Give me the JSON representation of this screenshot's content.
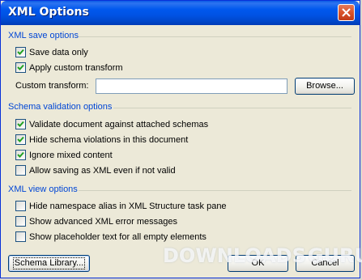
{
  "window": {
    "title": "XML Options",
    "close_icon": "close-icon"
  },
  "groups": {
    "save": {
      "title": "XML save options",
      "items": [
        {
          "label": "Save data only",
          "checked": true
        },
        {
          "label": "Apply custom transform",
          "checked": true
        }
      ],
      "custom_transform_label": "Custom transform:",
      "custom_transform_value": "",
      "browse_label": "Browse..."
    },
    "schema": {
      "title": "Schema validation options",
      "items": [
        {
          "label": "Validate document against attached schemas",
          "checked": true
        },
        {
          "label": "Hide schema violations in this document",
          "checked": true
        },
        {
          "label": "Ignore mixed content",
          "checked": true
        },
        {
          "label": "Allow saving as XML even if not valid",
          "checked": false
        }
      ]
    },
    "view": {
      "title": "XML view options",
      "items": [
        {
          "label": "Hide namespace alias in XML Structure task pane",
          "checked": false
        },
        {
          "label": "Show advanced XML error messages",
          "checked": false
        },
        {
          "label": "Show placeholder text for all empty elements",
          "checked": false
        }
      ]
    }
  },
  "buttons": {
    "schema_library": "Schema Library...",
    "ok": "OK",
    "cancel": "Cancel"
  },
  "watermark": {
    "text_left": "DOWNLOADS",
    "text_right": "GURU"
  },
  "colors": {
    "title_bar": "#0054e3",
    "group_title": "#0046d5",
    "dialog_bg": "#ece9d8"
  }
}
